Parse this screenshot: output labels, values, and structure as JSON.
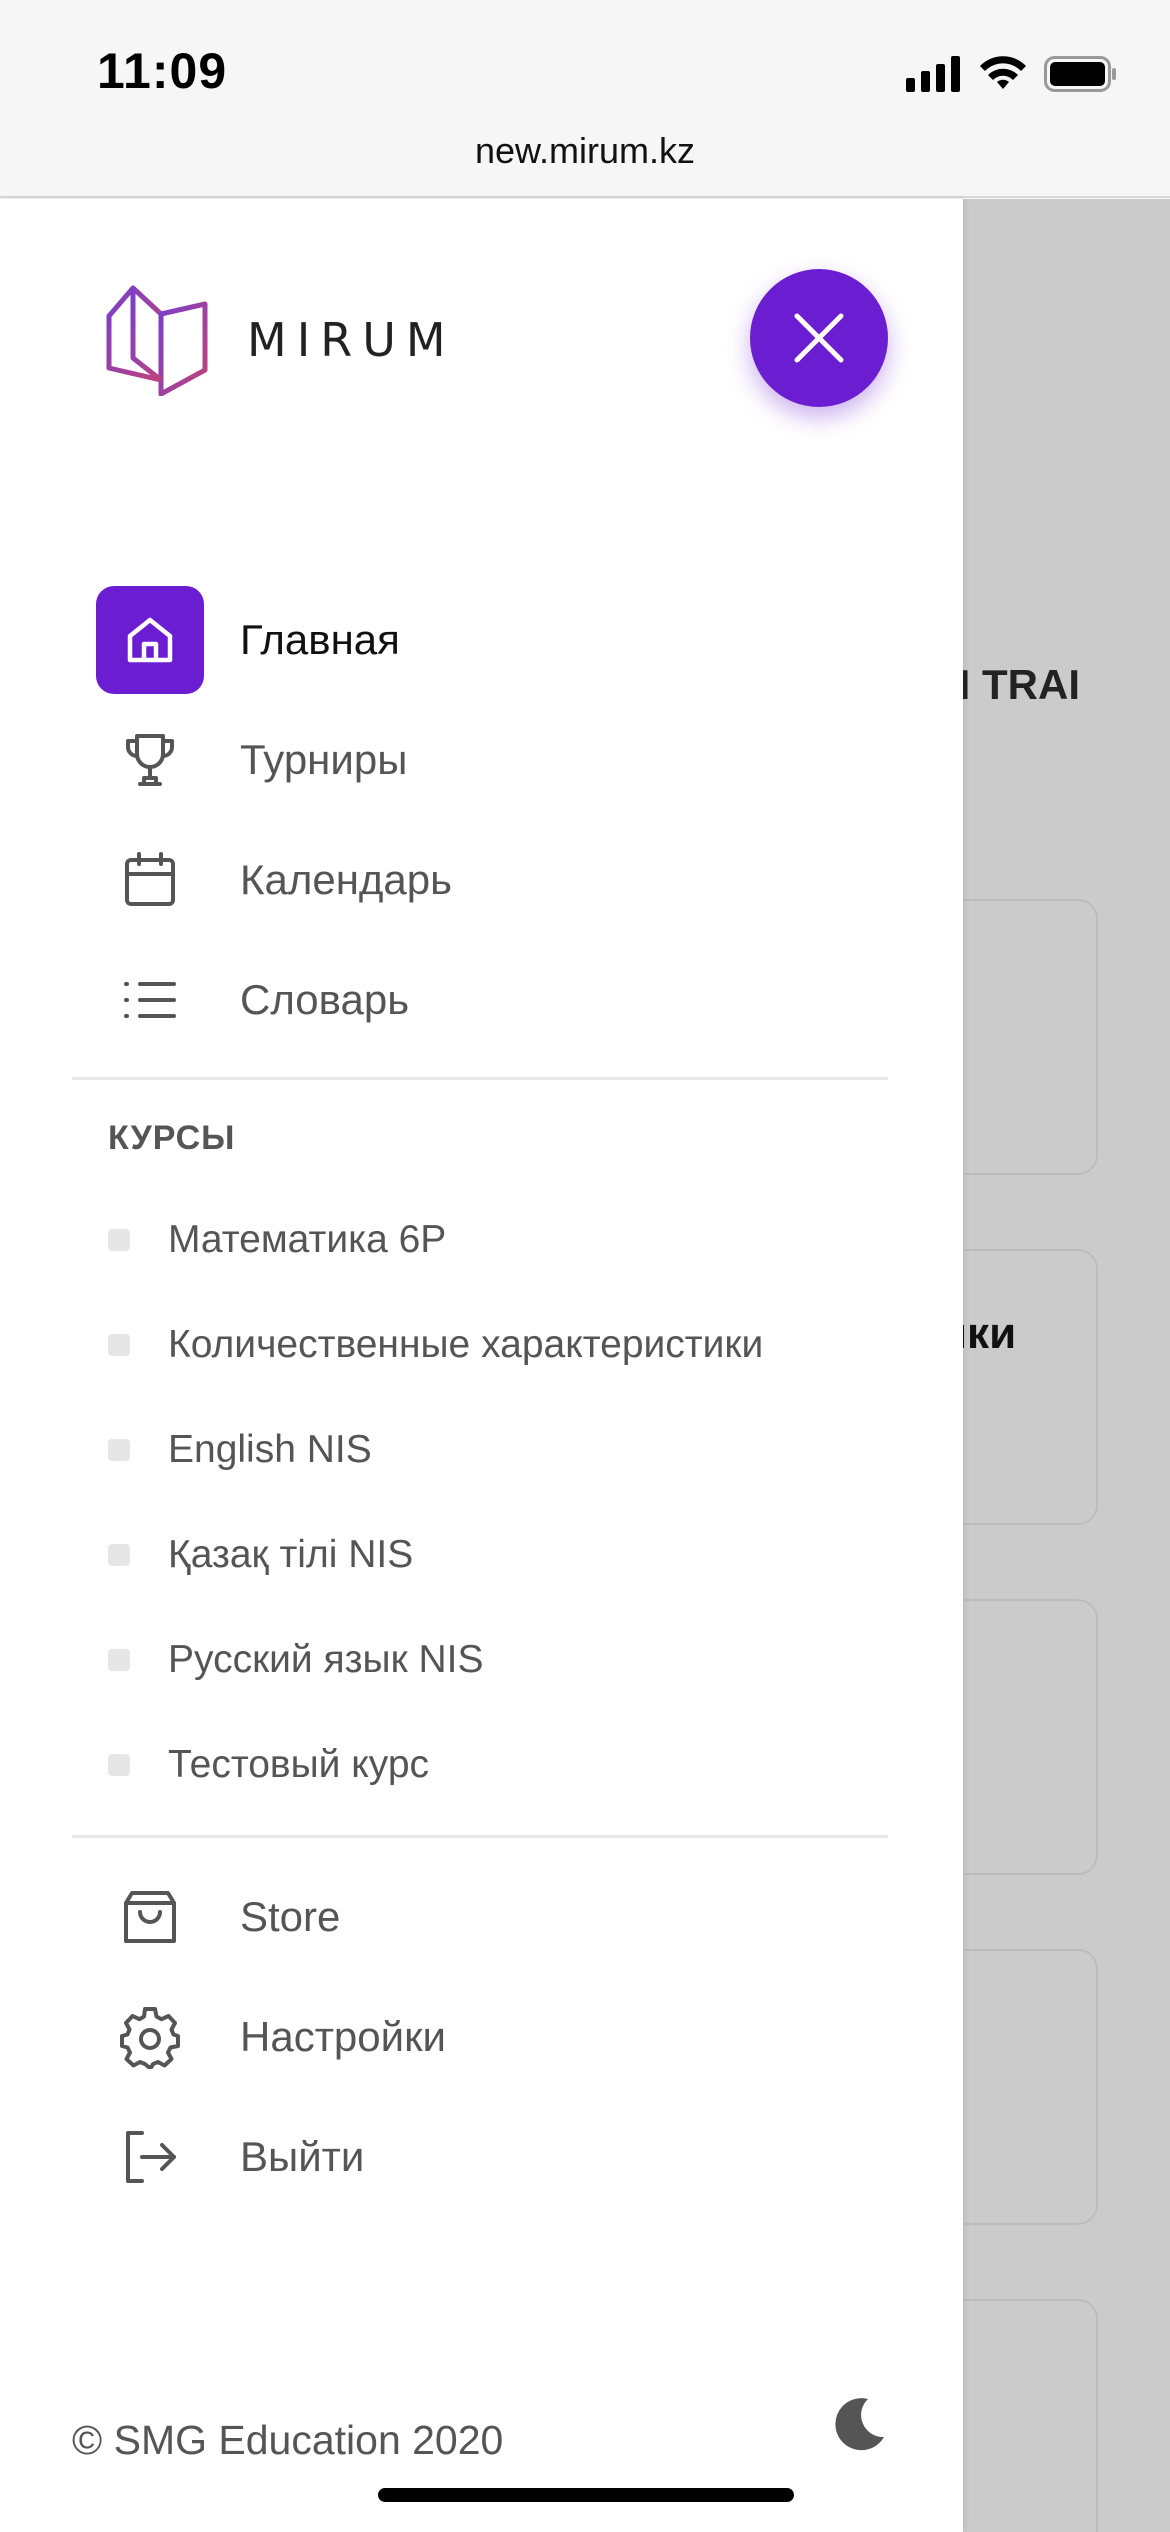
{
  "status_bar": {
    "time": "11:09"
  },
  "browser": {
    "url": "new.mirum.kz"
  },
  "drawer": {
    "logo_text": "MIRUM",
    "nav_items": [
      {
        "label": "Главная",
        "icon": "home-icon",
        "active": true
      },
      {
        "label": "Турниры",
        "icon": "trophy-icon",
        "active": false
      },
      {
        "label": "Календарь",
        "icon": "calendar-icon",
        "active": false
      },
      {
        "label": "Словарь",
        "icon": "list-icon",
        "active": false
      }
    ],
    "courses_title": "КУРСЫ",
    "courses": [
      "Математика 6Р",
      "Количественные характеристики",
      "English NIS",
      "Қазақ тілі NIS",
      "Русский язык NIS",
      "Тестовый курс"
    ],
    "bottom_items": [
      {
        "label": "Store",
        "icon": "shopping-bag-icon"
      },
      {
        "label": "Настройки",
        "icon": "gear-icon"
      },
      {
        "label": "Выйти",
        "icon": "logout-icon"
      }
    ],
    "footer": "© SMG Education 2020"
  },
  "background": {
    "heading_partial": "N TRAI",
    "heading_partial_2": "ики"
  },
  "colors": {
    "accent": "#6b1ed1",
    "logo_gradient_start": "#7a3fc8",
    "logo_gradient_end": "#c0437a"
  }
}
